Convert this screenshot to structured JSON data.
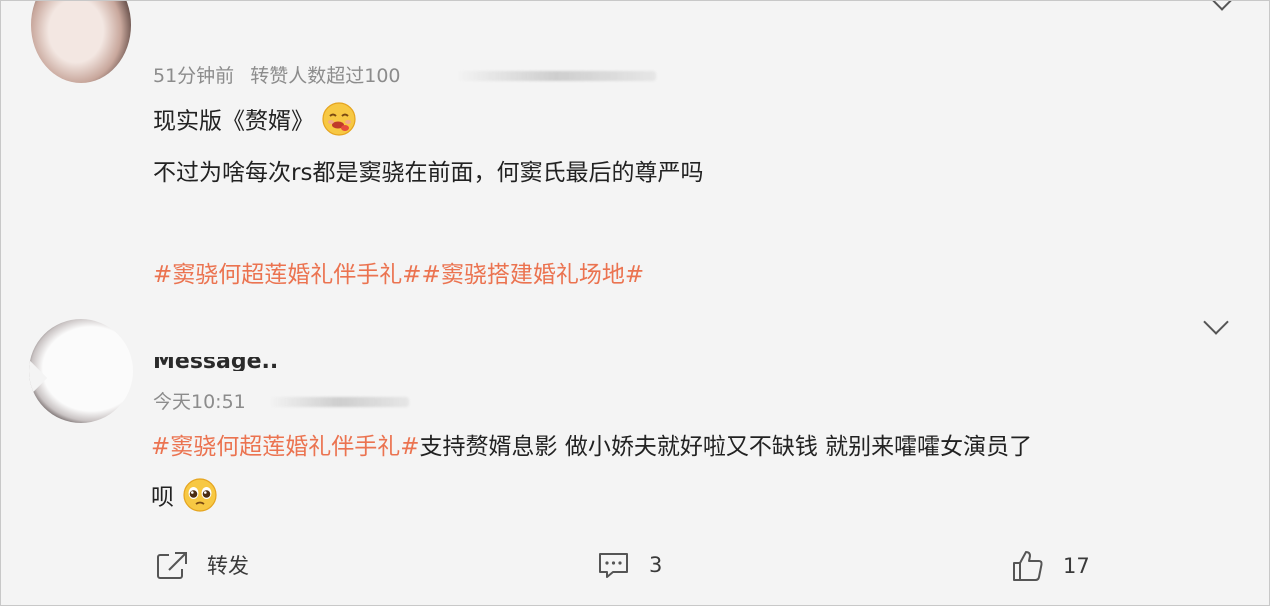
{
  "comments": [
    {
      "time": "51分钟前",
      "badge": "转赞人数超过100",
      "lines": [
        {
          "text": "现实版《赘婿》",
          "emoji": "drooling-face-emoji"
        },
        {
          "text": "不过为啥每次rs都是窦骁在前面，何窦氏最后的尊严吗"
        }
      ],
      "hashtags": "#窦骁何超莲婚礼伴手礼##窦骁搭建婚礼场地#"
    },
    {
      "username": "Message..",
      "time": "今天10:51",
      "hashtag": "#窦骁何超莲婚礼伴手礼#",
      "text_line1": "支持赘婿息影 做小娇夫就好啦又不缺钱 就别来嚯嚯女演员了",
      "text_line2": "呗",
      "emoji": "pleading-face-emoji"
    }
  ],
  "actions": {
    "repost_label": "转发",
    "comment_count": "3",
    "like_count": "17"
  },
  "icons": [
    "chevron-down-icon",
    "share-icon",
    "comment-icon",
    "thumbs-up-icon"
  ],
  "colors": {
    "hashtag": "#eb7350",
    "meta": "#8c8c8c",
    "background": "#f4f4f4"
  }
}
